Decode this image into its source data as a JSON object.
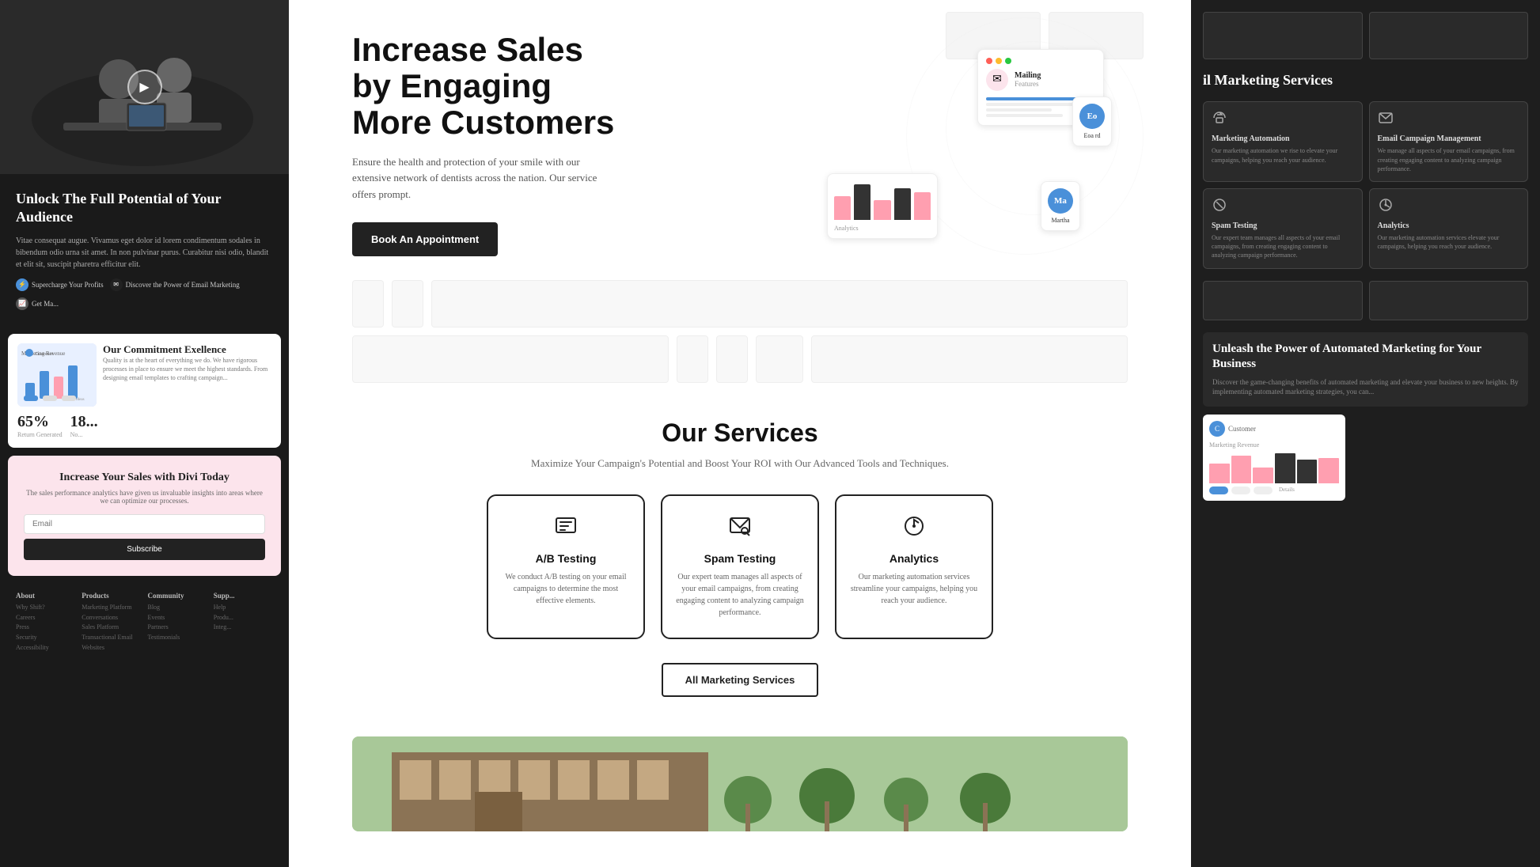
{
  "hero": {
    "title_line1": "Increase Sales",
    "title_line2": "by Engaging",
    "title_line3": "More Customers",
    "subtitle": "Ensure the health and protection of your smile with our extensive network of dentists across the nation. Our service offers prompt.",
    "book_button": "Book An Appointment"
  },
  "hero_visual": {
    "mailing_label": "Mailing",
    "features_label": "Features",
    "profile1_initials": "Eo",
    "profile1_name": "Eoa rd",
    "profile2_initials": "Ma",
    "profile2_name": "Martha"
  },
  "services": {
    "title": "Our Services",
    "subtitle": "Maximize Your Campaign's Potential and Boost Your ROI with Our Advanced Tools and Techniques.",
    "cards": [
      {
        "icon": "📋",
        "title": "A/B Testing",
        "body": "We conduct A/B testing on your email campaigns to determine the most effective elements."
      },
      {
        "icon": "📧",
        "title": "Spam Testing",
        "body": "Our expert team manages all aspects of your email campaigns, from creating engaging content to analyzing campaign performance."
      },
      {
        "icon": "📊",
        "title": "Analytics",
        "body": "Our marketing automation services streamline your campaigns, helping you reach your audience."
      }
    ],
    "all_button": "All Marketing Services"
  },
  "left_sidebar": {
    "section1_title": "Unlock The Full Potential of Your Audience",
    "section1_body": "Vitae consequat augue. Vivamus eget dolor id lorem condimentum sodales in bibendum odio urna sit amet. In non pulvinar purus. Curabitur nisi odio, blandit et elit sit, suscipit pharetra efficitur elit.",
    "icon1_label": "Supercharge Your Profits",
    "icon2_label": "Discover the Power of Email Marketing",
    "icon3_label": "Get Ma...",
    "commitment_title": "Our Commitment Exellence",
    "commitment_body": "Quality is at the heart of everything we do. We have rigorous processes in place to ensure we meet the highest standards. From designing email templates to crafting campaign...",
    "stat1_value": "65%",
    "stat1_label": "Return Generated",
    "stat2_value": "18...",
    "stat2_label": "No...",
    "cta_title": "Increase Your Sales with Divi Today",
    "cta_body": "The sales performance analytics have given us invaluable insights into areas where we can optimize our processes.",
    "cta_placeholder": "Email",
    "cta_button": "Subscribe"
  },
  "right_sidebar": {
    "title": "il Marketing Services",
    "service1_title": "Marketing Automation",
    "service1_body": "Our marketing automation we rise to elevate your campaigns, helping you reach your audience.",
    "service2_title": "Email Campaign Management",
    "service2_body": "We manage all aspects of your email campaigns, from creating engaging content to analyzing campaign performance.",
    "service3_title": "Spam Testing",
    "service3_body": "Our expert team manages all aspects of your email campaigns, from creating engaging content to analyzing campaign performance.",
    "service4_title": "Analytics",
    "service4_body": "Our marketing automation services elevate your campaigns, helping you reach your audience.",
    "bottom_title": "Unleash the Power of Automated Marketing for Your Business",
    "bottom_body": "Discover the game-changing benefits of automated marketing and elevate your business to new heights. By implementing automated marketing strategies, you can..."
  },
  "footer": {
    "col1_title": "About",
    "col1_items": [
      "Why Shift?",
      "Careers",
      "Press",
      "Security",
      "Accessibility"
    ],
    "col2_title": "Products",
    "col2_items": [
      "Marketing Platform",
      "Conversations",
      "Sales Platform",
      "Transactional Email",
      "Websites"
    ],
    "col3_title": "Community",
    "col3_items": [
      "Blog",
      "Events",
      "Partners",
      "Testimonials"
    ],
    "col4_title": "Supp...",
    "col4_items": [
      "Help",
      "Produ...",
      "Integ..."
    ]
  },
  "colors": {
    "accent_blue": "#4a90d9",
    "accent_pink": "#fce4ec",
    "dark": "#111111",
    "medium_gray": "#666666",
    "light_gray": "#f5f5f5",
    "border": "#eeeeee"
  }
}
